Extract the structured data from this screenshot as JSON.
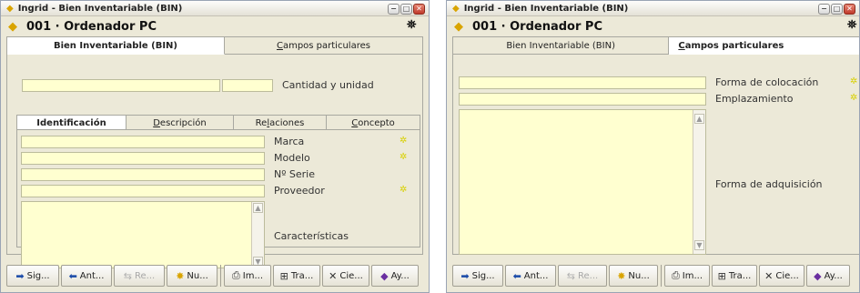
{
  "window_left": {
    "title": "Ingrid - Bien Inventariable (BIN)",
    "header": "001 · Ordenador PC",
    "main_tabs": [
      {
        "pre": "",
        "u": "",
        "post": "Bien Inventariable (BIN)",
        "active": true
      },
      {
        "pre": "",
        "u": "C",
        "post": "ampos particulares",
        "active": false
      }
    ],
    "labels": {
      "cantidad": "Cantidad y unidad",
      "marca": "Marca",
      "modelo": "Modelo",
      "serie": "Nº Serie",
      "proveedor": "Proveedor",
      "caracteristicas": "Características"
    },
    "sub_tabs": [
      {
        "pre": "",
        "u": "",
        "post": "Identificación",
        "active": true
      },
      {
        "pre": "",
        "u": "D",
        "post": "escripción",
        "active": false
      },
      {
        "pre": "Re",
        "u": "l",
        "post": "aciones",
        "active": false
      },
      {
        "pre": "",
        "u": "C",
        "post": "oncepto",
        "active": false
      }
    ]
  },
  "window_right": {
    "title": "Ingrid - Bien Inventariable (BIN)",
    "header": "001 · Ordenador PC",
    "main_tabs": [
      {
        "pre": "",
        "u": "",
        "post": "Bien Inventariable (BIN)",
        "active": false
      },
      {
        "pre": "",
        "u": "C",
        "post": "ampos particulares",
        "active": true
      }
    ],
    "labels": {
      "colocacion": "Forma de colocación",
      "emplazamiento": "Emplazamiento",
      "adquisicion": "Forma de adquisición"
    }
  },
  "buttons_left": [
    {
      "label": "Sig...",
      "icon": "arrow-right-icon",
      "glyph": "➡",
      "color": "#1a4aa8",
      "disabled": false
    },
    {
      "label": "Ant...",
      "icon": "arrow-left-icon",
      "glyph": "⬅",
      "color": "#1a4aa8",
      "disabled": false
    },
    {
      "label": "Re...",
      "icon": "refresh-icon",
      "glyph": "⇆",
      "color": "#b0b0b0",
      "disabled": true
    },
    {
      "label": "Nu...",
      "icon": "new-icon",
      "glyph": "✸",
      "color": "#d9a400",
      "disabled": false
    },
    {
      "label": "Im...",
      "icon": "print-icon",
      "glyph": "⎙",
      "color": "#333333",
      "disabled": false
    },
    {
      "label": "Tra...",
      "icon": "transfer-icon",
      "glyph": "⊞",
      "color": "#333333",
      "disabled": false
    },
    {
      "label": "Cie...",
      "icon": "close-icon",
      "glyph": "✕",
      "color": "#333333",
      "disabled": false
    },
    {
      "label": "Ay...",
      "icon": "help-icon",
      "glyph": "◆",
      "color": "#6a2fa0",
      "disabled": false
    }
  ],
  "buttons_right": [
    {
      "label": "Sig...",
      "icon": "arrow-right-icon",
      "glyph": "➡",
      "color": "#1a4aa8",
      "disabled": false
    },
    {
      "label": "Ant...",
      "icon": "arrow-left-icon",
      "glyph": "⬅",
      "color": "#1a4aa8",
      "disabled": false
    },
    {
      "label": "Re...",
      "icon": "refresh-icon",
      "glyph": "⇆",
      "color": "#b0b0b0",
      "disabled": true
    },
    {
      "label": "Nu...",
      "icon": "new-icon",
      "glyph": "✸",
      "color": "#d9a400",
      "disabled": false
    },
    {
      "label": "Im...",
      "icon": "print-icon",
      "glyph": "⎙",
      "color": "#333333",
      "disabled": false
    },
    {
      "label": "Tra...",
      "icon": "transfer-icon",
      "glyph": "⊞",
      "color": "#333333",
      "disabled": false
    },
    {
      "label": "Cie...",
      "icon": "close-icon",
      "glyph": "✕",
      "color": "#333333",
      "disabled": false
    },
    {
      "label": "Ay...",
      "icon": "help-icon",
      "glyph": "◆",
      "color": "#6a2fa0",
      "disabled": false
    }
  ]
}
